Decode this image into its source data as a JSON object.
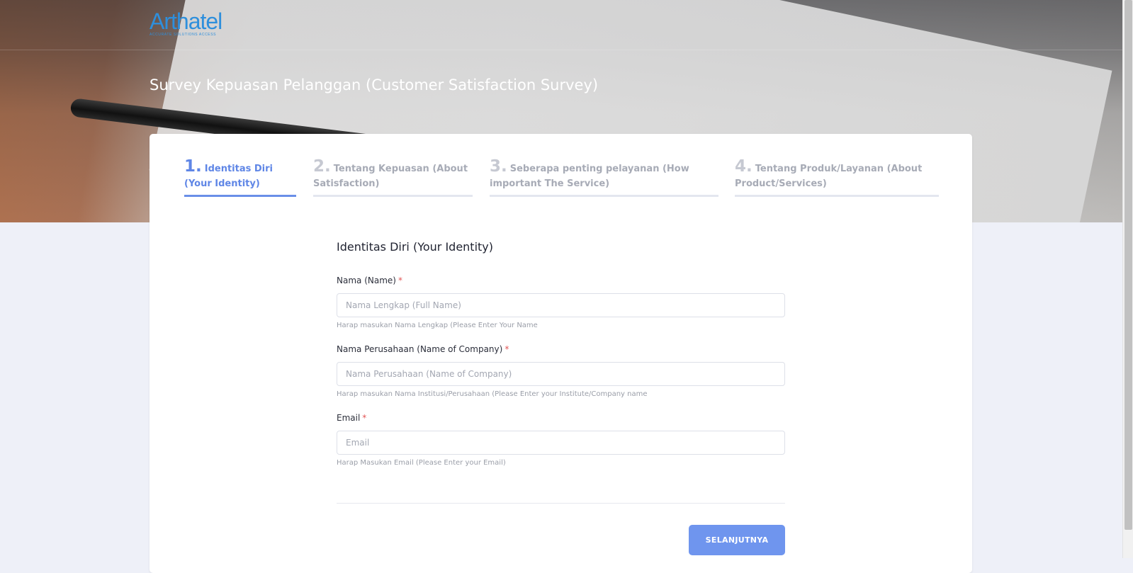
{
  "brand": {
    "logo_text": "Arthatel",
    "tagline": "ACCURATE SOLUTIONS ACCESS",
    "accent_color": "#2e8fdc"
  },
  "page": {
    "title": "Survey Kepuasan Pelanggan (Customer Satisfaction Survey)"
  },
  "steps": [
    {
      "number": "1.",
      "label": "Identitas Diri (Your Identity)",
      "active": true
    },
    {
      "number": "2.",
      "label": "Tentang Kepuasan (About Satisfaction)",
      "active": false
    },
    {
      "number": "3.",
      "label": "Seberapa penting pelayanan (How important The Service)",
      "active": false
    },
    {
      "number": "4.",
      "label": "Tentang Produk/Layanan (About Product/Services)",
      "active": false
    }
  ],
  "form": {
    "section_title": "Identitas Diri (Your Identity)",
    "required_mark": "*",
    "fields": [
      {
        "label": "Nama (Name)",
        "value": "",
        "placeholder": "Nama Lengkap (Full Name)",
        "help": "Harap masukan Nama Lengkap (Please Enter Your Name"
      },
      {
        "label": "Nama Perusahaan (Name of Company)",
        "value": "",
        "placeholder": "Nama Perusahaan (Name of Company)",
        "help": "Harap masukan Nama Institusi/Perusahaan (Please Enter your Institute/Company name"
      },
      {
        "label": "Email",
        "value": "",
        "placeholder": "Email",
        "help": "Harap Masukan Email (Please Enter your Email)"
      }
    ],
    "next_button": "SELANJUTNYA"
  },
  "colors": {
    "primary": "#6f95ee",
    "active_step": "#5f86e6",
    "required": "#e25555"
  }
}
